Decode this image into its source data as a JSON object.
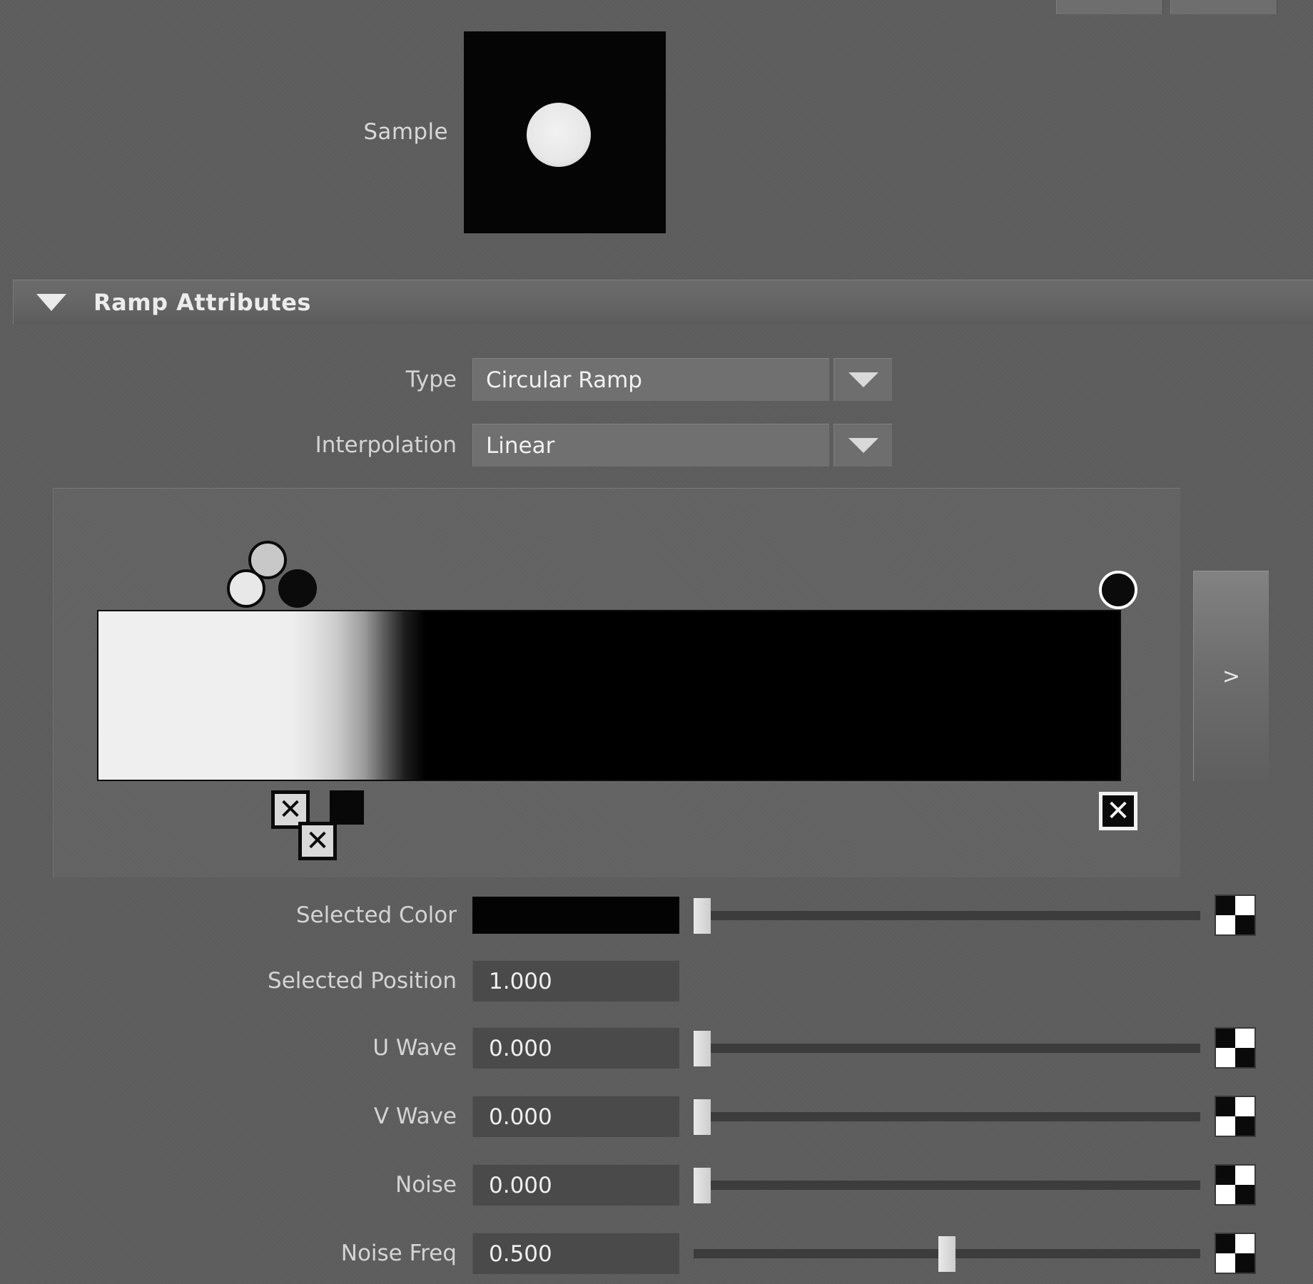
{
  "window": {
    "top_stub_buttons": [
      "",
      ""
    ]
  },
  "sample": {
    "label": "Sample",
    "swatch_bg": "#050505",
    "dot_color": "#eeeeee"
  },
  "section": {
    "title": "Ramp Attributes",
    "collapse_icon": "triangle-down-icon",
    "expanded": true
  },
  "options": [
    {
      "label": "Type",
      "value": "Circular Ramp",
      "icon": "chevron-down-icon"
    },
    {
      "label": "Interpolation",
      "value": "Linear",
      "icon": "chevron-down-icon"
    }
  ],
  "ramp": {
    "expand_button_label": ">",
    "gradient_stops": [
      {
        "position": 0.0,
        "color": "#efefef"
      },
      {
        "position": 0.18,
        "color": "#eeeeee"
      },
      {
        "position": 0.21,
        "color": "#c9c9c9"
      },
      {
        "position": 0.3,
        "color": "#1d1d1d"
      },
      {
        "position": 0.32,
        "color": "#000000"
      },
      {
        "position": 1.0,
        "color": "#000000"
      }
    ],
    "markers": [
      {
        "name": "ramp-marker-light-gray",
        "position": 0.16,
        "color": "#c8c8c8",
        "selected": false,
        "row": 0
      },
      {
        "name": "ramp-marker-white",
        "position": 0.145,
        "color": "#e8e8e8",
        "selected": false,
        "row": 1
      },
      {
        "name": "ramp-marker-black",
        "position": 0.195,
        "color": "#0b0b0b",
        "selected": false,
        "row": 1
      },
      {
        "name": "ramp-marker-selected-black",
        "position": 1.0,
        "color": "#0b0b0b",
        "selected": true,
        "row": 1
      }
    ],
    "delete_handles": [
      {
        "name": "ramp-delete-handle-1",
        "position": 0.145,
        "inverted": false,
        "glyph": "✕",
        "row": 0
      },
      {
        "name": "ramp-delete-handle-2",
        "position": 0.165,
        "inverted": false,
        "glyph": "✕",
        "row": 1
      },
      {
        "name": "ramp-delete-handle-3",
        "position": 1.0,
        "inverted": true,
        "glyph": "✕",
        "row": 0
      }
    ],
    "black_chip": {
      "name": "ramp-color-chip",
      "color": "#080808"
    }
  },
  "attributes": [
    {
      "label": "Selected Color",
      "kind": "color",
      "color": "#030303",
      "has_slider": true,
      "slider_pct": 0.0,
      "has_map_button": true,
      "map_icon": "checker-map-icon"
    },
    {
      "label": "Selected Position",
      "kind": "number",
      "value": "1.000",
      "has_slider": false,
      "slider_pct": null,
      "has_map_button": false,
      "map_icon": ""
    },
    {
      "label": "U Wave",
      "kind": "number",
      "value": "0.000",
      "has_slider": true,
      "slider_pct": 0.0,
      "has_map_button": true,
      "map_icon": "checker-map-icon"
    },
    {
      "label": "V Wave",
      "kind": "number",
      "value": "0.000",
      "has_slider": true,
      "slider_pct": 0.0,
      "has_map_button": true,
      "map_icon": "checker-map-icon"
    },
    {
      "label": "Noise",
      "kind": "number",
      "value": "0.000",
      "has_slider": true,
      "slider_pct": 0.0,
      "has_map_button": true,
      "map_icon": "checker-map-icon"
    },
    {
      "label": "Noise Freq",
      "kind": "number",
      "value": "0.500",
      "has_slider": true,
      "slider_pct": 0.5,
      "has_map_button": true,
      "map_icon": "checker-map-icon"
    }
  ],
  "colors": {
    "panel_bg": "#5d5d5d",
    "field_bg": "#4a4a4a",
    "dropdown_bg": "#707070",
    "text": "#d4d4d4",
    "black": "#000000"
  }
}
